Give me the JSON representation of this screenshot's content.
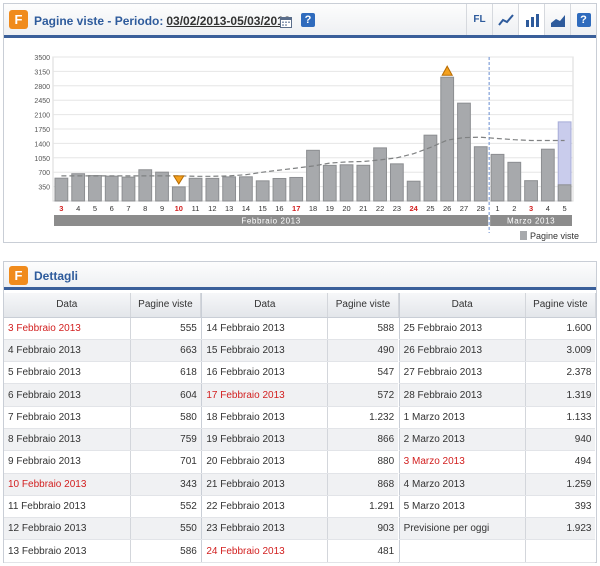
{
  "chart_panel": {
    "title": "Pagine viste - Periodo:",
    "period": "03/02/2013-05/03/2013",
    "help": "?",
    "tools": {
      "fl": "FL",
      "line": "line-chart-icon",
      "bar": "bar-chart-icon",
      "area": "area-chart-icon"
    }
  },
  "chart_data": {
    "type": "bar",
    "categories": [
      "3",
      "4",
      "5",
      "6",
      "7",
      "8",
      "9",
      "10",
      "11",
      "12",
      "13",
      "14",
      "15",
      "16",
      "17",
      "18",
      "19",
      "20",
      "21",
      "22",
      "23",
      "24",
      "25",
      "26",
      "27",
      "28",
      "1",
      "2",
      "3",
      "4",
      "5"
    ],
    "red_categories": [
      0,
      7,
      14,
      21,
      28
    ],
    "values": [
      555,
      663,
      618,
      604,
      580,
      759,
      701,
      343,
      552,
      550,
      586,
      588,
      490,
      547,
      572,
      1232,
      866,
      880,
      868,
      1291,
      903,
      481,
      1600,
      3009,
      2378,
      1319,
      1133,
      940,
      494,
      1259,
      393
    ],
    "forecast_last": 1923,
    "trend": [
      610,
      610,
      610,
      610,
      610,
      610,
      610,
      610,
      600,
      600,
      610,
      640,
      700,
      750,
      800,
      850,
      920,
      950,
      960,
      1000,
      1050,
      1150,
      1300,
      1480,
      1540,
      1550,
      1520,
      1490,
      1470,
      1470,
      1470
    ],
    "yticks": [
      350,
      700,
      1050,
      1400,
      1750,
      2100,
      2450,
      2800,
      3150,
      3500
    ],
    "ylim": [
      0,
      3500
    ],
    "months": [
      {
        "label": "Febbraio 2013",
        "from": 0,
        "to": 25
      },
      {
        "label": "Marzo 2013",
        "from": 26,
        "to": 30
      }
    ],
    "legend": "Pagine viste",
    "marker_max_index": 23,
    "marker_min_index": 7,
    "series_color": "#a7a9ac",
    "forecast_color": "#c9ccec"
  },
  "details": {
    "title": "Dettagli",
    "col_date": "Data",
    "col_views": "Pagine viste",
    "columns": [
      [
        {
          "d": "3 Febbraio 2013",
          "v": "555",
          "red": true
        },
        {
          "d": "4 Febbraio 2013",
          "v": "663",
          "red": false
        },
        {
          "d": "5 Febbraio 2013",
          "v": "618",
          "red": false
        },
        {
          "d": "6 Febbraio 2013",
          "v": "604",
          "red": false
        },
        {
          "d": "7 Febbraio 2013",
          "v": "580",
          "red": false
        },
        {
          "d": "8 Febbraio 2013",
          "v": "759",
          "red": false
        },
        {
          "d": "9 Febbraio 2013",
          "v": "701",
          "red": false
        },
        {
          "d": "10 Febbraio 2013",
          "v": "343",
          "red": true
        },
        {
          "d": "11 Febbraio 2013",
          "v": "552",
          "red": false
        },
        {
          "d": "12 Febbraio 2013",
          "v": "550",
          "red": false
        },
        {
          "d": "13 Febbraio 2013",
          "v": "586",
          "red": false
        }
      ],
      [
        {
          "d": "14 Febbraio 2013",
          "v": "588",
          "red": false
        },
        {
          "d": "15 Febbraio 2013",
          "v": "490",
          "red": false
        },
        {
          "d": "16 Febbraio 2013",
          "v": "547",
          "red": false
        },
        {
          "d": "17 Febbraio 2013",
          "v": "572",
          "red": true
        },
        {
          "d": "18 Febbraio 2013",
          "v": "1.232",
          "red": false
        },
        {
          "d": "19 Febbraio 2013",
          "v": "866",
          "red": false
        },
        {
          "d": "20 Febbraio 2013",
          "v": "880",
          "red": false
        },
        {
          "d": "21 Febbraio 2013",
          "v": "868",
          "red": false
        },
        {
          "d": "22 Febbraio 2013",
          "v": "1.291",
          "red": false
        },
        {
          "d": "23 Febbraio 2013",
          "v": "903",
          "red": false
        },
        {
          "d": "24 Febbraio 2013",
          "v": "481",
          "red": true
        }
      ],
      [
        {
          "d": "25 Febbraio 2013",
          "v": "1.600",
          "red": false
        },
        {
          "d": "26 Febbraio 2013",
          "v": "3.009",
          "red": false
        },
        {
          "d": "27 Febbraio 2013",
          "v": "2.378",
          "red": false
        },
        {
          "d": "28 Febbraio 2013",
          "v": "1.319",
          "red": false
        },
        {
          "d": "1 Marzo 2013",
          "v": "1.133",
          "red": false
        },
        {
          "d": "2 Marzo 2013",
          "v": "940",
          "red": false
        },
        {
          "d": "3 Marzo 2013",
          "v": "494",
          "red": true
        },
        {
          "d": "4 Marzo 2013",
          "v": "1.259",
          "red": false
        },
        {
          "d": "5 Marzo 2013",
          "v": "393",
          "red": false
        },
        {
          "d": "Previsione per oggi",
          "v": "1.923",
          "red": false
        },
        {
          "d": "",
          "v": "",
          "red": false
        }
      ]
    ]
  }
}
